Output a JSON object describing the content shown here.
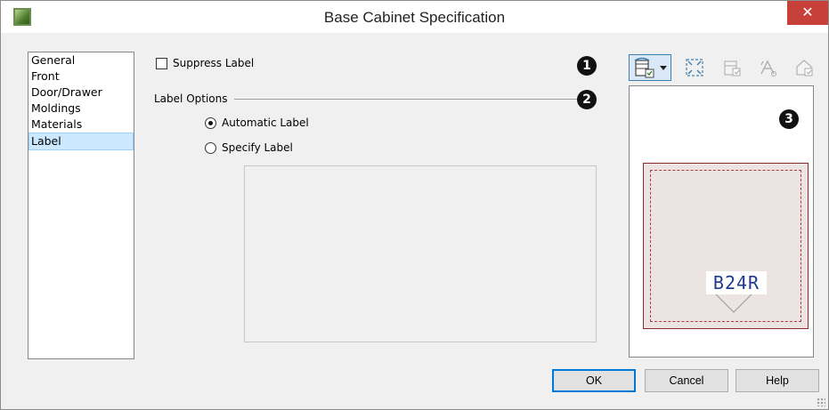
{
  "window": {
    "title": "Base Cabinet Specification",
    "close_label": "✕"
  },
  "nav": {
    "items": [
      {
        "label": "General"
      },
      {
        "label": "Front"
      },
      {
        "label": "Door/Drawer"
      },
      {
        "label": "Moldings"
      },
      {
        "label": "Materials"
      },
      {
        "label": "Label"
      }
    ],
    "selected": "Label"
  },
  "label_panel": {
    "suppress_label": {
      "label": "Suppress Label",
      "checked": false
    },
    "group_title": "Label Options",
    "radio_options": [
      {
        "label": "Automatic Label",
        "checked": true
      },
      {
        "label": "Specify Label",
        "checked": false
      }
    ],
    "specify_value": ""
  },
  "callouts": [
    "1",
    "2",
    "3"
  ],
  "toolbar": {
    "icons": [
      "cabinet-view-dropdown-icon",
      "fill-window-icon",
      "elevation-view-icon",
      "camera-icon",
      "perspective-view-icon"
    ]
  },
  "preview": {
    "cabinet_label": "B24R"
  },
  "buttons": {
    "ok": "OK",
    "cancel": "Cancel",
    "help": "Help"
  },
  "colors": {
    "close_red": "#c7403a",
    "selection": "#cce8ff",
    "cabinet_outline": "#8a2c2c",
    "cabinet_fill": "#ebe4e2",
    "label_text": "#1f3a8a"
  }
}
